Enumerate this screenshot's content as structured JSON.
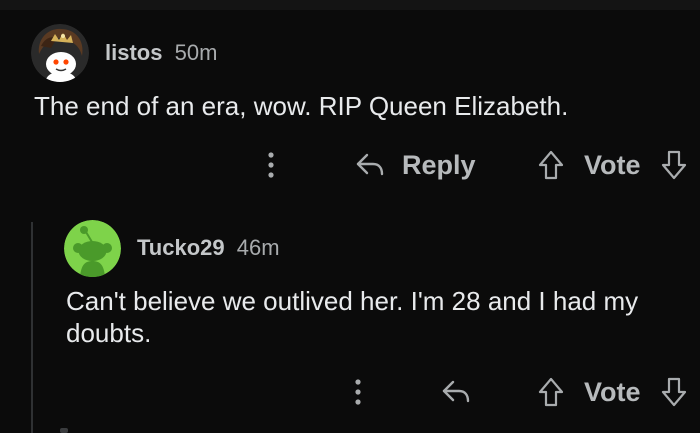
{
  "comments": [
    {
      "username": "listos",
      "age": "50m",
      "text": "The end of an era, wow. RIP Queen Elizabeth.",
      "actions": {
        "reply_label": "Reply",
        "vote_label": "Vote"
      },
      "avatar": {
        "icon": "snoo-avatar-custom",
        "bg": "#2a2a2a"
      }
    },
    {
      "username": "Tucko29",
      "age": "46m",
      "text": "Can't believe we outlived her. I'm 28 and I had my doubts.",
      "actions": {
        "vote_label": "Vote"
      },
      "avatar": {
        "icon": "snoo-avatar-default",
        "bg": "#7ed34a"
      }
    }
  ],
  "colors": {
    "background": "#0b0b0b",
    "text": "#e8eaec",
    "muted": "#a9acae",
    "thread_line": "#2f3133"
  }
}
